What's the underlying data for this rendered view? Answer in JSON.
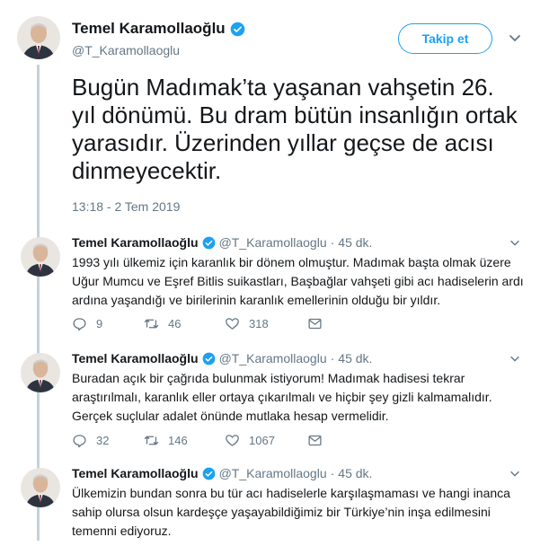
{
  "account": {
    "name": "Temel Karamollaoğlu",
    "handle": "@T_Karamollaoglu"
  },
  "main_tweet": {
    "follow_label": "Takip et",
    "text": "Bugün Madımak’ta yaşanan vahşetin 26. yıl dönümü. Bu dram bütün insanlığın ortak yarasıdır. Üzerinden yıllar geçse de acısı dinmeyecektir.",
    "timestamp": "13:18 - 2 Tem 2019"
  },
  "replies": [
    {
      "name": "Temel Karamollaoğlu",
      "handle": "@T_Karamollaoglu",
      "separator": "·",
      "time": "45 dk.",
      "text": "1993 yılı ülkemiz için karanlık bir dönem olmuştur. Madımak başta olmak üzere\nUğur Mumcu ve Eşref Bitlis suikastları, Başbağlar vahşeti gibi acı hadiselerin ardı\nardına yaşandığı ve birilerinin karanlık emellerinin olduğu bir yıldır.",
      "replies_count": "9",
      "retweets_count": "46",
      "likes_count": "318"
    },
    {
      "name": "Temel Karamollaoğlu",
      "handle": "@T_Karamollaoglu",
      "separator": "·",
      "time": "45 dk.",
      "text": "Buradan açık bir çağrıda bulunmak istiyorum! Madımak hadisesi tekrar\naraştırılmalı, karanlık eller ortaya çıkarılmalı ve hiçbir şey gizli kalmamalıdır.\nGerçek suçlular adalet önünde mutlaka hesap vermelidir.",
      "replies_count": "32",
      "retweets_count": "146",
      "likes_count": "1067"
    },
    {
      "name": "Temel Karamollaoğlu",
      "handle": "@T_Karamollaoglu",
      "separator": "·",
      "time": "45 dk.",
      "text": "Ülkemizin bundan sonra bu tür acı hadiselerle karşılaşmaması ve hangi inanca\nsahip olursa olsun kardeşçe yaşayabildiğimiz bir Türkiye’nin inşa edilmesini\ntemenni ediyoruz."
    }
  ],
  "colors": {
    "accent": "#1da1f2",
    "secondary_text": "#657786",
    "thread_line": "#c4d2dc"
  },
  "icons": [
    "verified-badge-icon",
    "chevron-down-icon",
    "reply-icon",
    "retweet-icon",
    "like-icon",
    "direct-message-icon"
  ]
}
